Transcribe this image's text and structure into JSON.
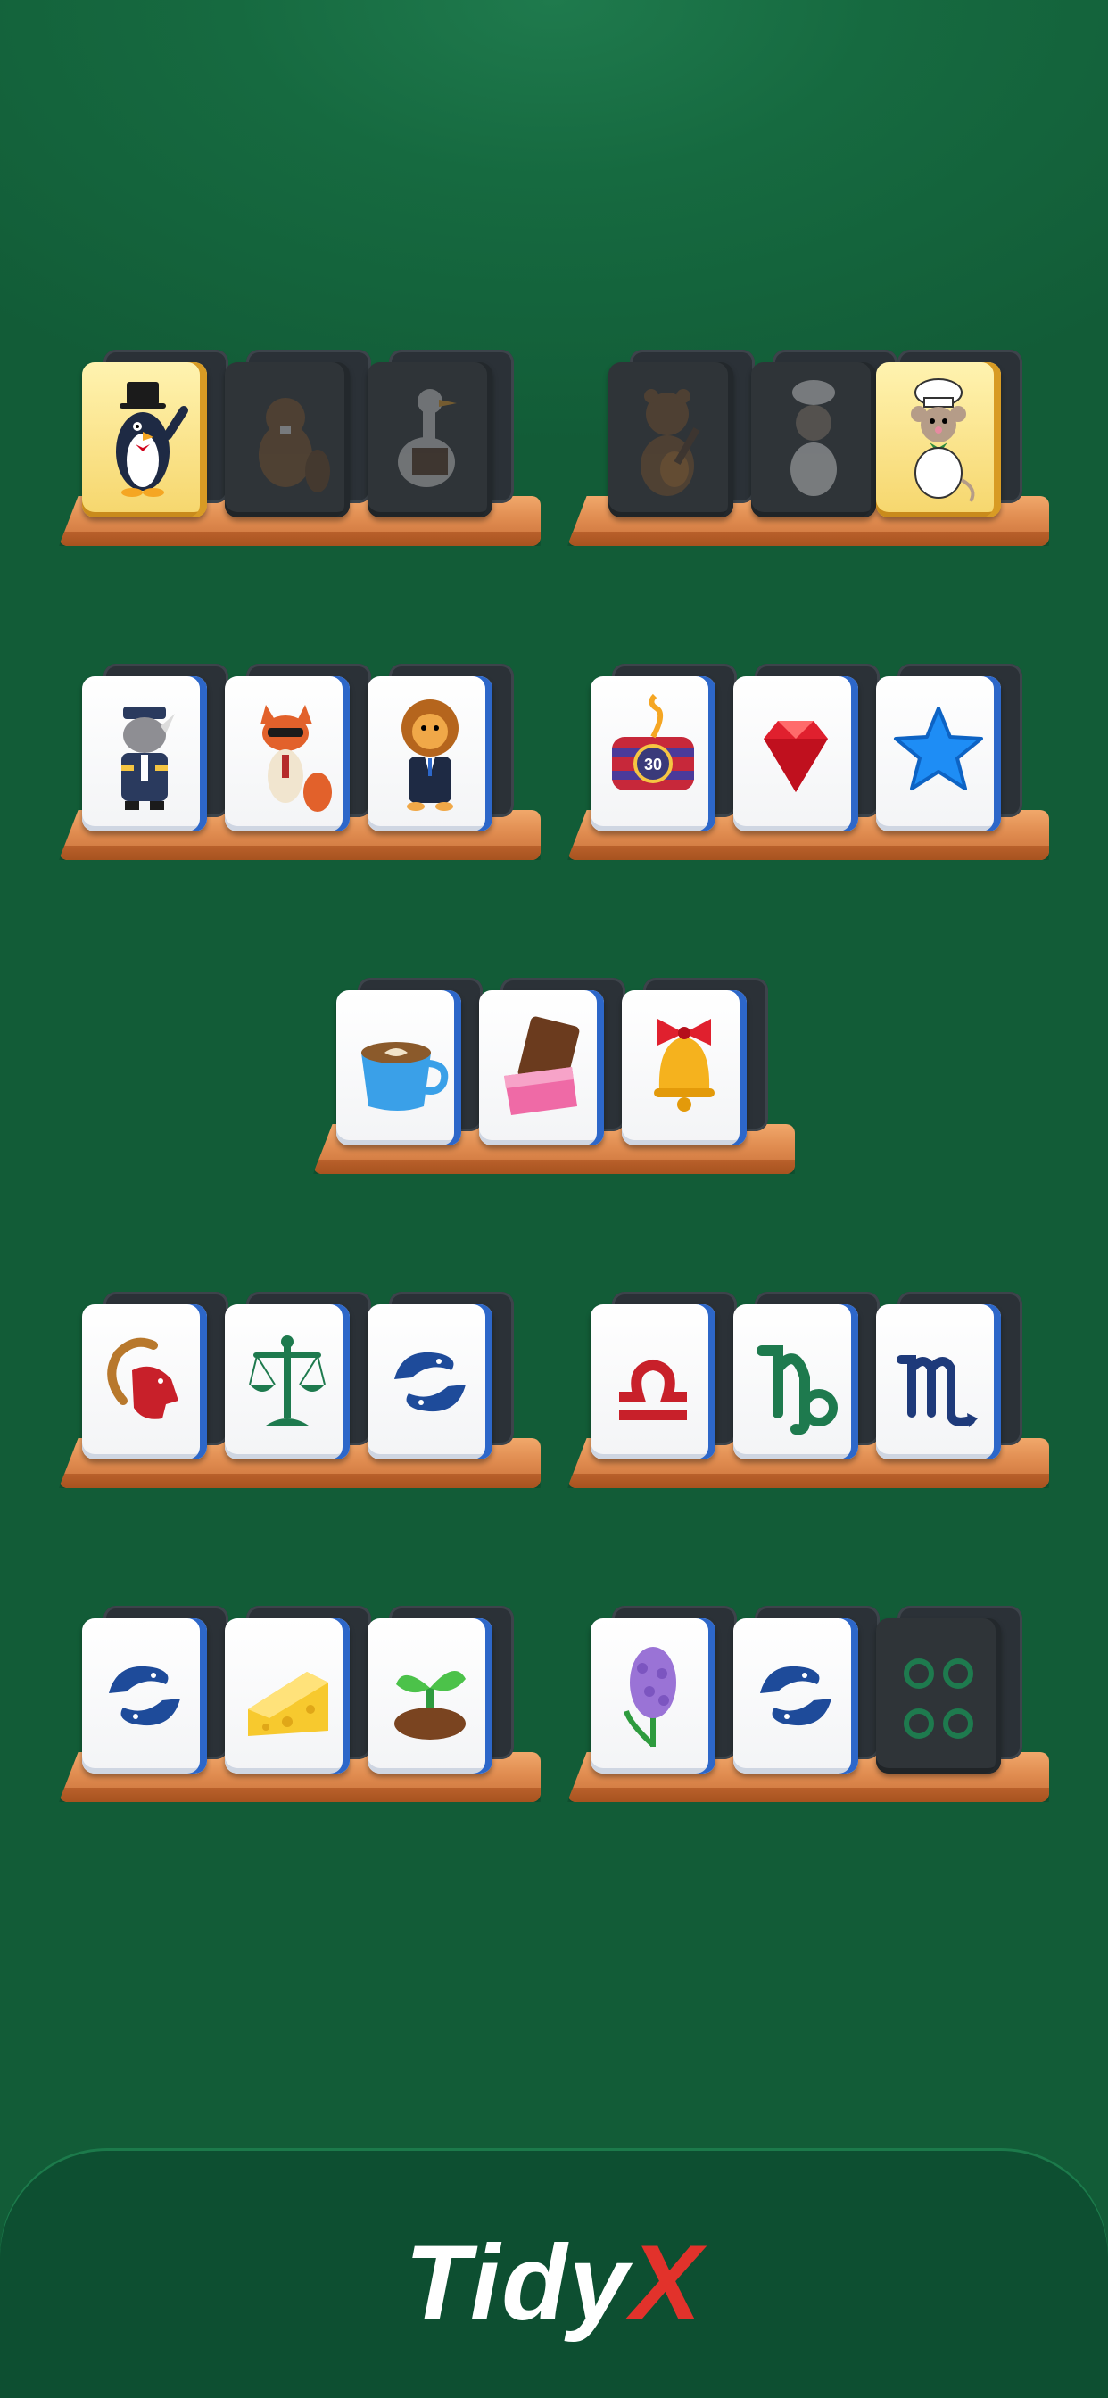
{
  "game": {
    "title": "TidyX",
    "logo_main": "Tidy",
    "logo_accent": "X",
    "colors": {
      "background": "#166a40",
      "footer": "#0d4f31",
      "shelf": "#e08c50",
      "tile_face": "#ffffff",
      "tile_edge": "#2d67c9",
      "accent_red": "#e2322b"
    }
  },
  "shelves": [
    {
      "id": "row1-left",
      "tiles": [
        {
          "icon": "penguin-in-top-hat",
          "state": "gold"
        },
        {
          "icon": "beaver",
          "state": "locked"
        },
        {
          "icon": "goose",
          "state": "locked"
        }
      ]
    },
    {
      "id": "row1-right",
      "tiles": [
        {
          "icon": "bear-with-guitar",
          "state": "locked"
        },
        {
          "icon": "chef-mouse",
          "state": "locked"
        },
        {
          "icon": "chef-mouse",
          "state": "gold"
        }
      ]
    },
    {
      "id": "row2-left",
      "tiles": [
        {
          "icon": "rhino-pilot",
          "state": "normal"
        },
        {
          "icon": "fox-with-sunglasses",
          "state": "normal"
        },
        {
          "icon": "lion-in-suit",
          "state": "normal"
        }
      ]
    },
    {
      "id": "row2-right",
      "tiles": [
        {
          "icon": "dynamite-timer-30",
          "label": "30",
          "state": "normal"
        },
        {
          "icon": "red-gem",
          "state": "normal"
        },
        {
          "icon": "blue-star",
          "state": "normal"
        }
      ]
    },
    {
      "id": "row3-center",
      "tiles": [
        {
          "icon": "latte-cup",
          "state": "normal"
        },
        {
          "icon": "chocolate-bar",
          "state": "normal"
        },
        {
          "icon": "red-bow-bell",
          "state": "normal"
        }
      ]
    },
    {
      "id": "row4-left",
      "tiles": [
        {
          "icon": "aries-ram",
          "state": "normal"
        },
        {
          "icon": "libra-scales",
          "state": "normal"
        },
        {
          "icon": "pisces-fish",
          "state": "normal"
        }
      ]
    },
    {
      "id": "row4-right",
      "tiles": [
        {
          "icon": "libra-symbol",
          "state": "normal"
        },
        {
          "icon": "capricorn-symbol",
          "state": "normal"
        },
        {
          "icon": "scorpio-symbol",
          "state": "normal"
        }
      ]
    },
    {
      "id": "row5-left",
      "tiles": [
        {
          "icon": "pisces-fish",
          "state": "normal"
        },
        {
          "icon": "cheese-wedge",
          "state": "normal"
        },
        {
          "icon": "sprout",
          "state": "normal"
        }
      ]
    },
    {
      "id": "row5-right",
      "tiles": [
        {
          "icon": "hyacinth-flower",
          "state": "normal"
        },
        {
          "icon": "pisces-fish",
          "state": "normal"
        },
        {
          "icon": "four-dots",
          "state": "locked"
        }
      ]
    }
  ]
}
